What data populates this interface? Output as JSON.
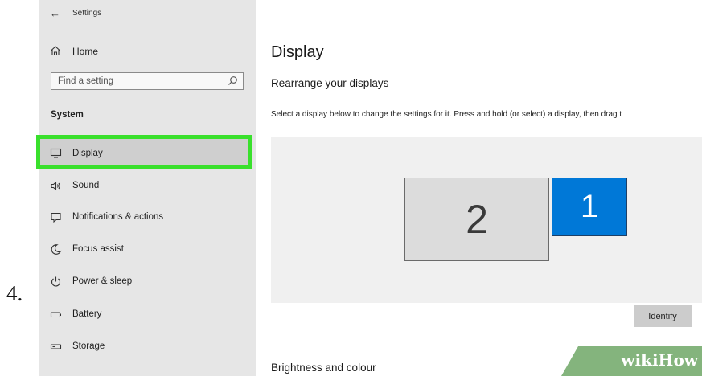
{
  "step_number": "4.",
  "sidebar": {
    "window_title": "Settings",
    "home_label": "Home",
    "search_placeholder": "Find a setting",
    "section_heading": "System",
    "items": [
      {
        "label": "Display",
        "icon": "monitor-icon",
        "selected": true
      },
      {
        "label": "Sound",
        "icon": "speaker-icon"
      },
      {
        "label": "Notifications & actions",
        "icon": "notifications-icon"
      },
      {
        "label": "Focus assist",
        "icon": "moon-icon"
      },
      {
        "label": "Power & sleep",
        "icon": "power-icon"
      },
      {
        "label": "Battery",
        "icon": "battery-icon"
      },
      {
        "label": "Storage",
        "icon": "storage-icon"
      }
    ]
  },
  "main": {
    "title": "Display",
    "subheading": "Rearrange your displays",
    "description": "Select a display below to change the settings for it. Press and hold (or select) a display, then drag t",
    "displays": [
      {
        "number": "2",
        "selected": false
      },
      {
        "number": "1",
        "selected": true
      }
    ],
    "identify_label": "Identify",
    "brightness_heading": "Brightness and colour"
  },
  "watermark": {
    "part1": "wiki",
    "part2": "How"
  },
  "colors": {
    "accent": "#0078d7",
    "highlight_border": "#39e02c",
    "sidebar_bg": "#e6e6e6",
    "watermark_bg": "#84b47d"
  }
}
